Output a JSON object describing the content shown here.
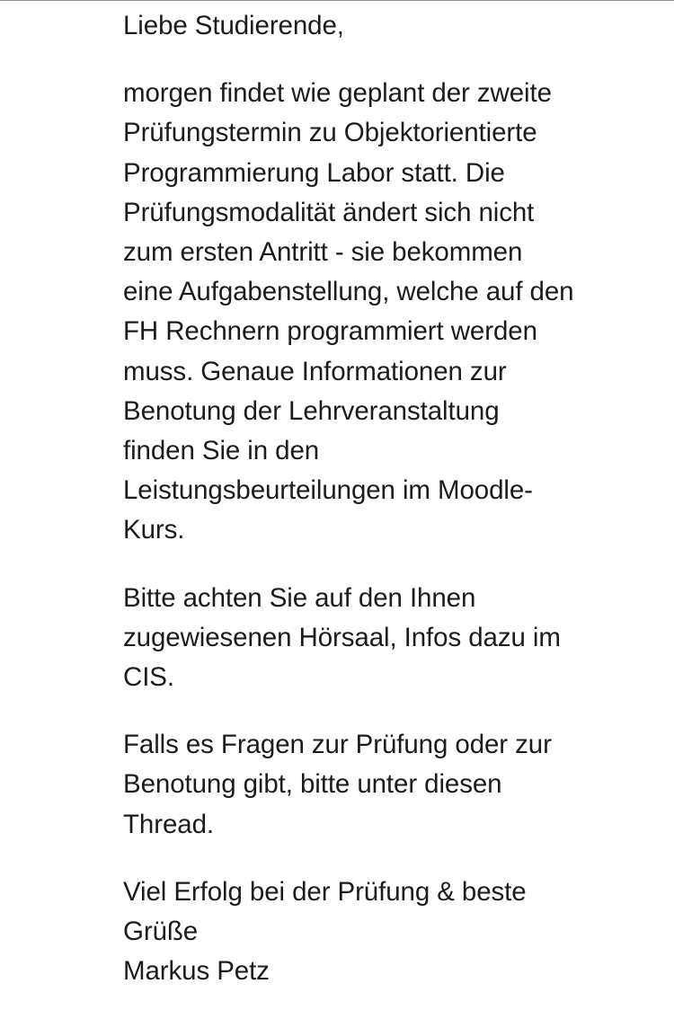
{
  "message": {
    "greeting": "Liebe Studierende,",
    "paragraphs": [
      {
        "lines": [
          "morgen findet wie geplant der zweite",
          "Prüfungstermin zu Objektorientierte",
          "Programmierung Labor statt. Die",
          "Prüfungsmodalität ändert sich nicht",
          "zum ersten Antritt - sie bekommen",
          "eine Aufgabenstellung, welche auf den",
          "FH Rechnern programmiert werden",
          "muss. Genaue Informationen zur",
          "Benotung der Lehrveranstaltung",
          "finden Sie in den",
          "Leistungsbeurteilungen im Moodle-",
          "Kurs."
        ]
      },
      {
        "lines": [
          "Bitte achten Sie auf den Ihnen",
          "zugewiesenen Hörsaal, Infos dazu im",
          "CIS."
        ]
      },
      {
        "lines": [
          "Falls es Fragen zur Prüfung oder zur",
          "Benotung gibt, bitte unter diesen",
          "Thread."
        ]
      }
    ],
    "closing": {
      "lines": [
        "Viel Erfolg bei der Prüfung & beste",
        "Grüße"
      ],
      "signature": "Markus Petz"
    }
  }
}
